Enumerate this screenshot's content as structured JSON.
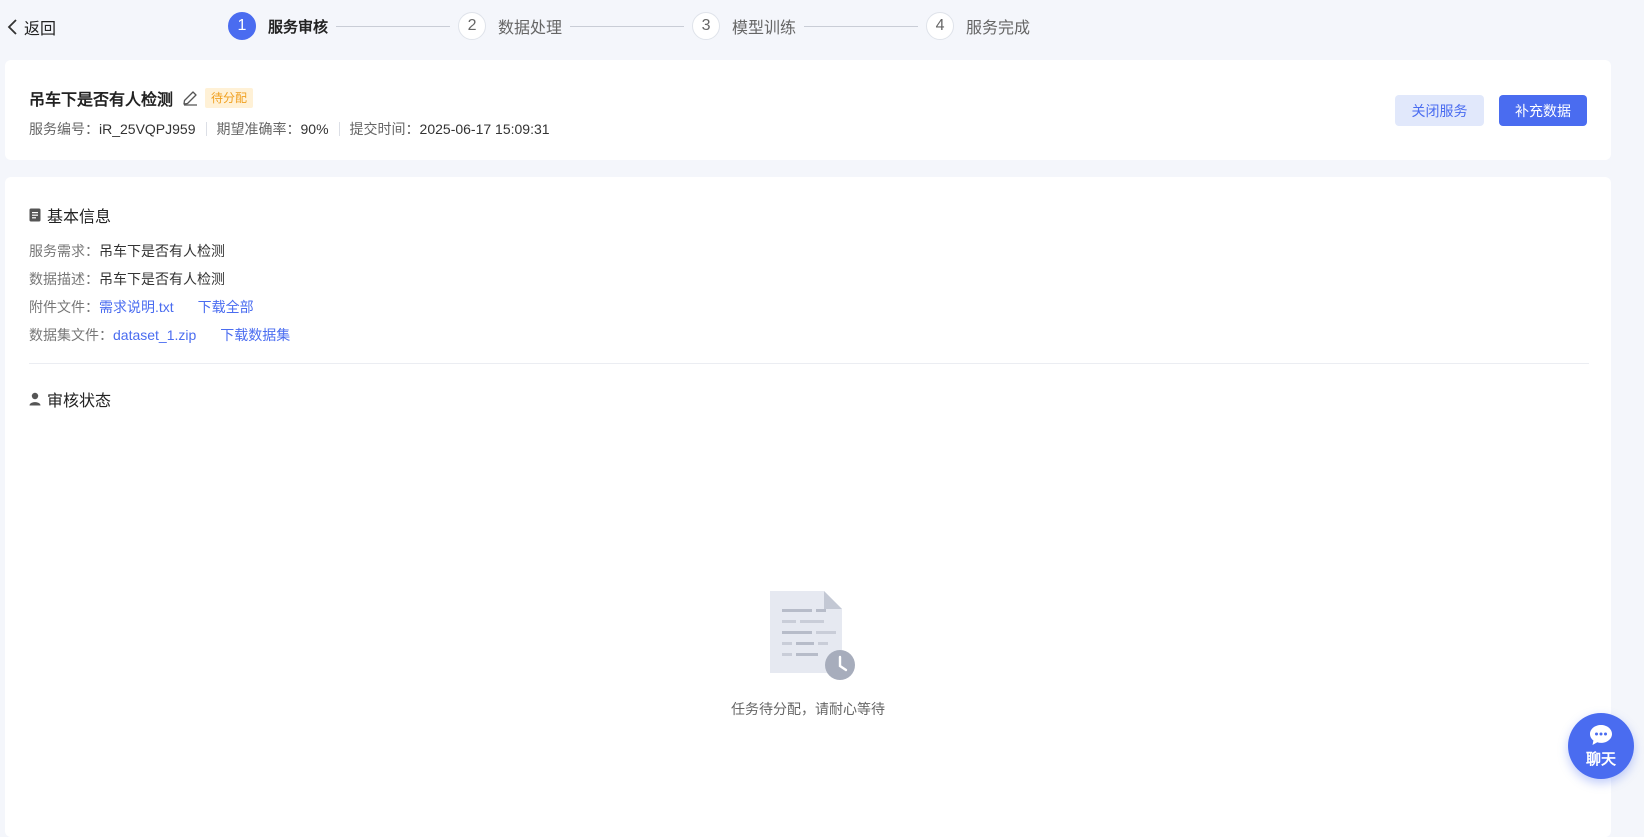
{
  "topbar": {
    "back_label": "返回",
    "steps": [
      {
        "num": "1",
        "label": "服务审核",
        "active": true
      },
      {
        "num": "2",
        "label": "数据处理",
        "active": false
      },
      {
        "num": "3",
        "label": "模型训练",
        "active": false
      },
      {
        "num": "4",
        "label": "服务完成",
        "active": false
      }
    ]
  },
  "header": {
    "title": "吊车下是否有人检测",
    "status_badge": "待分配",
    "meta": [
      {
        "label": "服务编号：",
        "value": "iR_25VQPJ959"
      },
      {
        "label": "期望准确率：",
        "value": "90%"
      },
      {
        "label": "提交时间：",
        "value": "2025-06-17 15:09:31"
      }
    ],
    "close_button": "关闭服务",
    "add_button": "补充数据"
  },
  "basic_info": {
    "title": "基本信息",
    "demand_label": "服务需求：",
    "demand_value": "吊车下是否有人检测",
    "desc_label": "数据描述：",
    "desc_value": "吊车下是否有人检测",
    "attach_label": "附件文件：",
    "attach_file": "需求说明.txt",
    "attach_download": "下载全部",
    "dataset_label": "数据集文件：",
    "dataset_file": "dataset_1.zip",
    "dataset_download": "下载数据集"
  },
  "review": {
    "title": "审核状态",
    "empty_text": "任务待分配，请耐心等待"
  },
  "chat": {
    "label": "聊天"
  },
  "colors": {
    "accent": "#4a6cf0",
    "badge_text": "#f0a020",
    "badge_bg": "#fff1d6"
  },
  "icons": [
    "chevron-left-icon",
    "edit-icon",
    "document-icon",
    "user-icon",
    "clock-document-icon",
    "chat-bubble-icon"
  ]
}
